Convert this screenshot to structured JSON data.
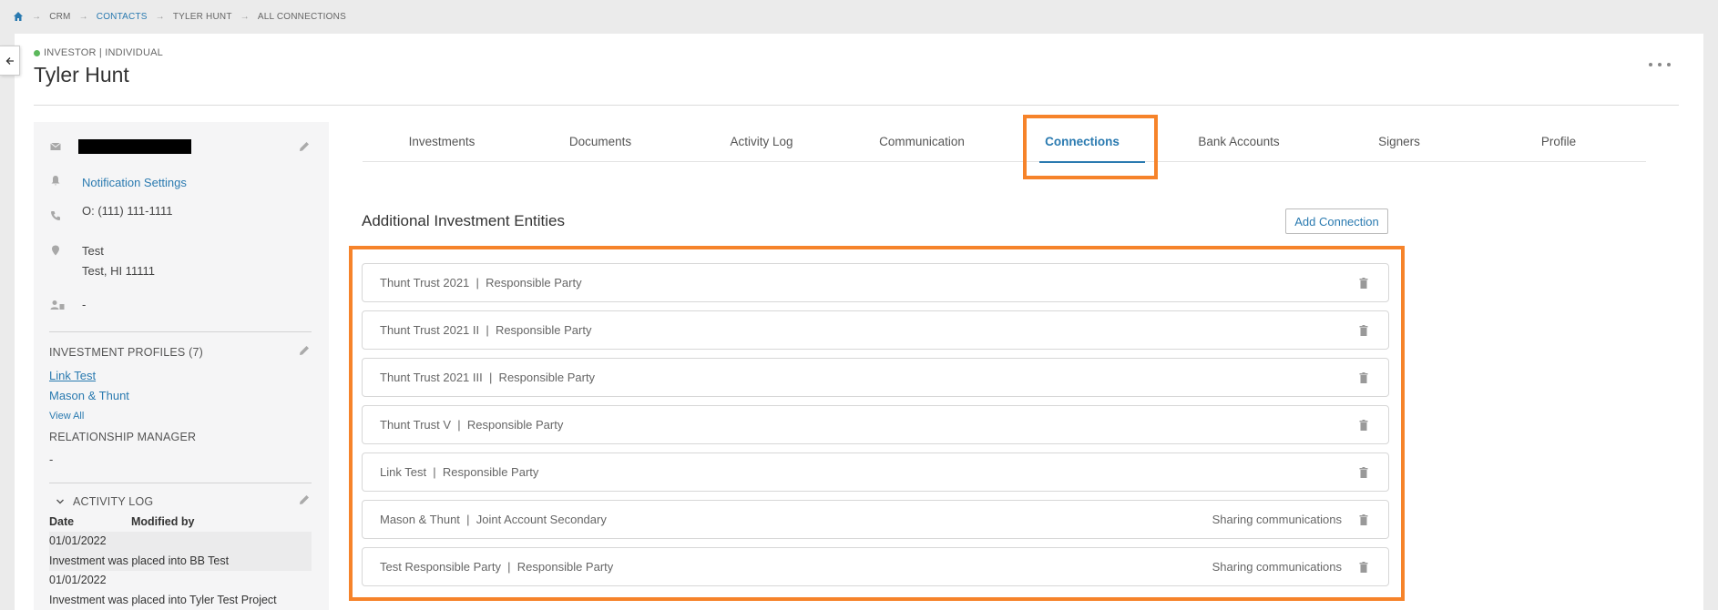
{
  "breadcrumb": [
    "CRM",
    "CONTACTS",
    "TYLER HUNT",
    "ALL CONNECTIONS"
  ],
  "header": {
    "type_label": "INVESTOR | INDIVIDUAL",
    "title": "Tyler Hunt"
  },
  "sidebar": {
    "notification_settings": "Notification Settings",
    "phone": "O: (111) 111-1111",
    "address_line1": "Test",
    "address_line2": "Test, HI 11111",
    "contact_owner": "-",
    "investment_profiles_heading": "INVESTMENT PROFILES (7)",
    "profiles": [
      "Link Test",
      "Mason & Thunt"
    ],
    "view_all": "View All",
    "relationship_manager_heading": "RELATIONSHIP MANAGER",
    "relationship_manager_value": "-",
    "activity_log_heading": "ACTIVITY LOG",
    "activity_columns": [
      "Date",
      "Modified by"
    ],
    "activity_entries": [
      {
        "date": "01/01/2022",
        "text": "Investment was placed into BB Test"
      },
      {
        "date": "01/01/2022",
        "text": "Investment was placed into Tyler Test Project"
      }
    ]
  },
  "tabs": [
    {
      "label": "Investments",
      "active": false
    },
    {
      "label": "Documents",
      "active": false
    },
    {
      "label": "Activity Log",
      "active": false
    },
    {
      "label": "Communication",
      "active": false
    },
    {
      "label": "Connections",
      "active": true
    },
    {
      "label": "Bank Accounts",
      "active": false
    },
    {
      "label": "Signers",
      "active": false
    },
    {
      "label": "Profile",
      "active": false
    }
  ],
  "connections_section": {
    "title": "Additional Investment Entities",
    "add_button": "Add Connection",
    "items": [
      {
        "label": "Thunt Trust 2021  |  Responsible Party",
        "sharing": ""
      },
      {
        "label": "Thunt Trust 2021 II  |  Responsible Party",
        "sharing": ""
      },
      {
        "label": "Thunt Trust 2021 III  |  Responsible Party",
        "sharing": ""
      },
      {
        "label": "Thunt Trust V  |  Responsible Party",
        "sharing": ""
      },
      {
        "label": "Link Test  |  Responsible Party",
        "sharing": ""
      },
      {
        "label": "Mason & Thunt  |  Joint Account Secondary",
        "sharing": "Sharing communications"
      },
      {
        "label": "Test Responsible Party  |  Responsible Party",
        "sharing": "Sharing communications"
      }
    ]
  },
  "colors": {
    "accent": "#2a7ab0",
    "highlight": "#f6832a",
    "status": "#5cb85c"
  }
}
